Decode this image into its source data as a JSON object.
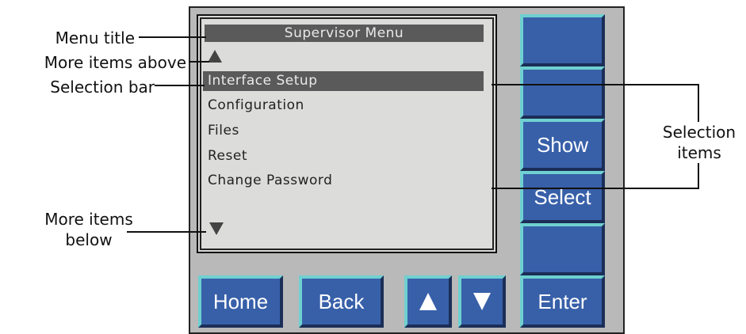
{
  "screen": {
    "title": "Supervisor Menu",
    "selected_item": "Interface Setup",
    "items": [
      "Configuration",
      "Files",
      "Reset",
      "Change Password"
    ]
  },
  "side_buttons": {
    "show": "Show",
    "select": "Select",
    "enter": "Enter"
  },
  "bottom_buttons": {
    "home": "Home",
    "back": "Back"
  },
  "callouts": {
    "menu_title": "Menu title",
    "more_above": "More items above",
    "selection_bar": "Selection bar",
    "more_below_1": "More items",
    "more_below_2": "below",
    "selection_items_1": "Selection",
    "selection_items_2": "items"
  },
  "colors": {
    "button": "#3860a9",
    "button_highlight": "#6fd0d0",
    "panel": "#b9b9ba",
    "lcd": "#dcdcda",
    "bar": "#5a5a5a"
  }
}
